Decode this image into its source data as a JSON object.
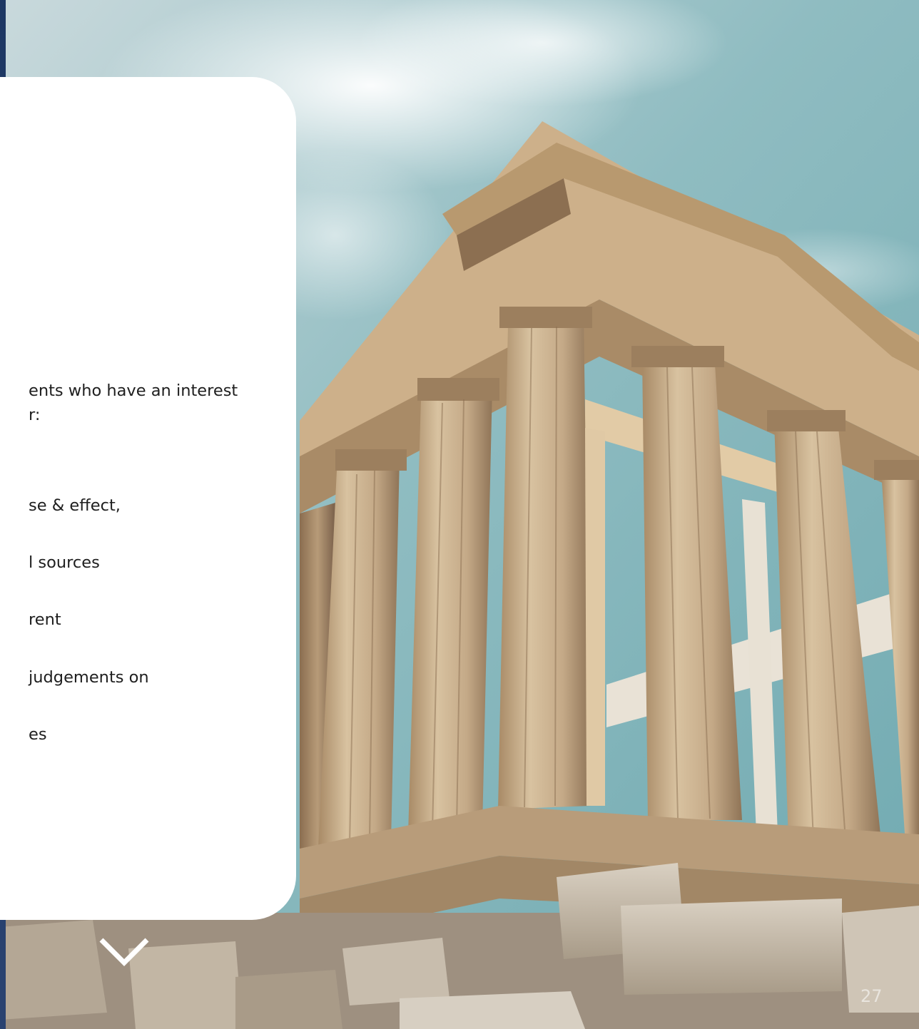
{
  "page": {
    "lines": [
      "ents who have an interest",
      "r:",
      "se & effect,",
      "l sources",
      "rent",
      "judgements on",
      "es"
    ],
    "page_number": "27"
  },
  "icons": {
    "scroll_down": "chevron-down-icon"
  },
  "colors": {
    "sky": "#7fb1b8",
    "marble": "#d9c4a4",
    "card": "#ffffff",
    "text": "#1e1e1e",
    "left_strip": "#1d3763"
  }
}
